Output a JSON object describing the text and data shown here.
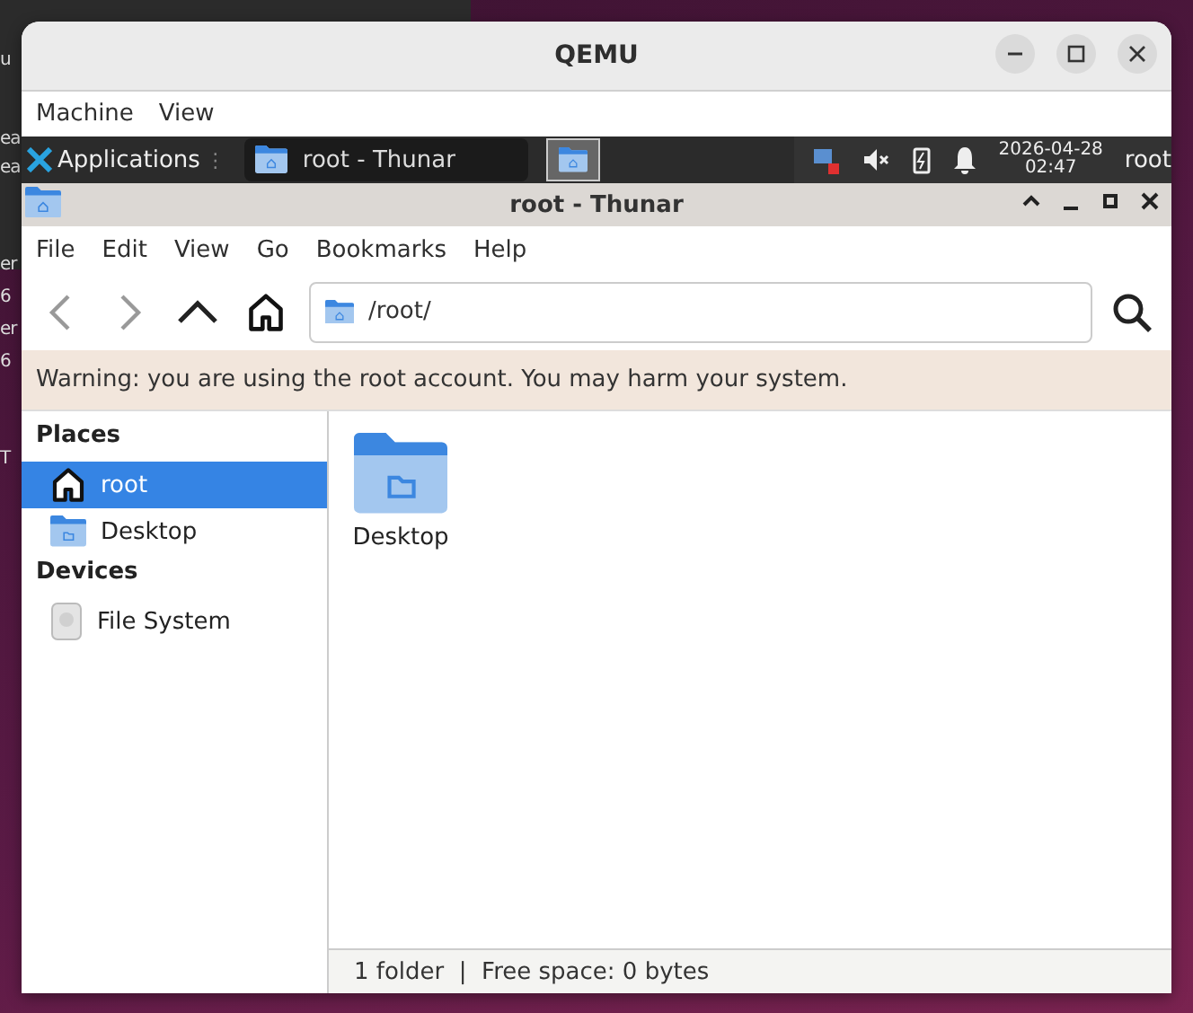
{
  "background_fragments": [
    "u",
    "ea",
    "ea",
    "er",
    "6",
    "er",
    "6",
    "T"
  ],
  "window": {
    "title": "QEMU",
    "menu": [
      "Machine",
      "View"
    ]
  },
  "guest_panel": {
    "applications": "Applications",
    "handle": "⋮",
    "tasks": [
      {
        "label": "root - Thunar",
        "selected": true
      }
    ],
    "clock_date": "2026-04-28",
    "clock_time": "02:47",
    "user": "root"
  },
  "file_manager": {
    "title": "root - Thunar",
    "menu": [
      "File",
      "Edit",
      "View",
      "Go",
      "Bookmarks",
      "Help"
    ],
    "location": "/root/",
    "warning": "Warning: you are using the root account. You may harm your system.",
    "sidebar": [
      {
        "heading": "Places",
        "items": [
          {
            "label": "root",
            "kind": "home",
            "selected": true
          },
          {
            "label": "Desktop",
            "kind": "folder",
            "selected": false
          }
        ]
      },
      {
        "heading": "Devices",
        "items": [
          {
            "label": "File System",
            "kind": "drive",
            "selected": false
          }
        ]
      }
    ],
    "files": [
      {
        "name": "Desktop"
      }
    ],
    "status_bar": "1 folder  |  Free space: 0 bytes"
  }
}
